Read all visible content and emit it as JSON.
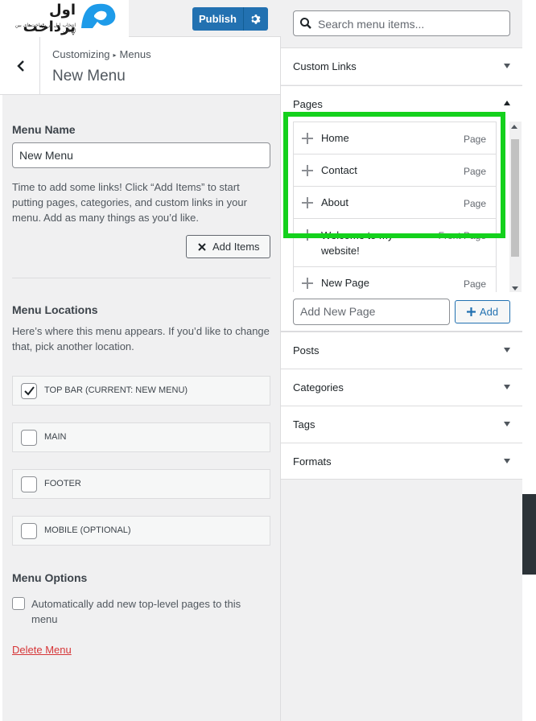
{
  "brand": {
    "logo_text": "اول پرداخت",
    "logo_subtitle": "انتخاب اول در پرداخت‌های بین المللی"
  },
  "topbar": {
    "publish_label": "Publish"
  },
  "header": {
    "breadcrumb_root": "Customizing",
    "breadcrumb_current": "Menus",
    "title": "New Menu"
  },
  "menu_name": {
    "label": "Menu Name",
    "value": "New Menu",
    "help": "Time to add some links! Click “Add Items” to start putting pages, categories, and custom links in your menu. Add as many things as you’d like.",
    "add_items_label": "Add Items"
  },
  "menu_locations": {
    "label": "Menu Locations",
    "help": "Here’s where this menu appears. If you’d like to change that, pick another location.",
    "items": [
      {
        "label": "TOP BAR (CURRENT: NEW MENU)",
        "checked": true
      },
      {
        "label": "MAIN",
        "checked": false
      },
      {
        "label": "FOOTER",
        "checked": false
      },
      {
        "label": "MOBILE (OPTIONAL)",
        "checked": false
      }
    ]
  },
  "menu_options": {
    "label": "Menu Options",
    "auto_add_label": "Automatically add new top-level pages to this menu",
    "auto_add_checked": false
  },
  "delete_label": "Delete Menu",
  "search": {
    "placeholder": "Search menu items..."
  },
  "sections": {
    "custom_links": "Custom Links",
    "pages": "Pages",
    "posts": "Posts",
    "categories": "Categories",
    "tags": "Tags",
    "formats": "Formats"
  },
  "pages": {
    "items": [
      {
        "name": "Home",
        "type": "Page"
      },
      {
        "name": "Contact",
        "type": "Page"
      },
      {
        "name": "About",
        "type": "Page"
      },
      {
        "name": "Welcome to my website!",
        "type": "Front Page"
      },
      {
        "name": "New Page",
        "type": "Page"
      }
    ],
    "new_page_placeholder": "Add New Page",
    "add_label": "Add"
  },
  "colors": {
    "accent": "#2271b1",
    "highlight": "#14d11c",
    "danger": "#d63638"
  }
}
